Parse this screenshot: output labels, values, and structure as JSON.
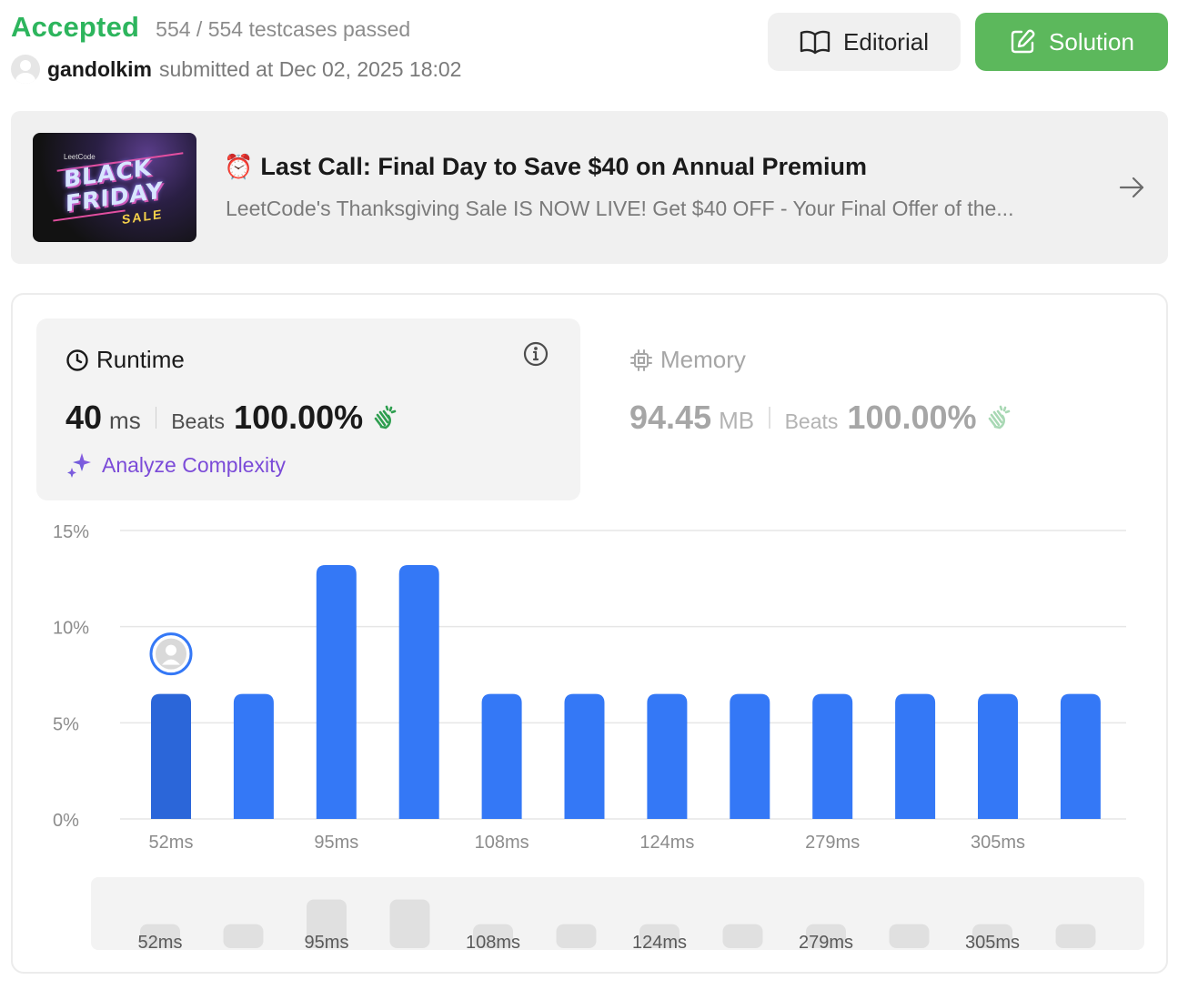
{
  "header": {
    "status": "Accepted",
    "testcases": "554 / 554 testcases passed",
    "username": "gandolkim",
    "submitted_text": "submitted at Dec 02, 2025 18:02",
    "editorial_label": "Editorial",
    "solution_label": "Solution"
  },
  "banner": {
    "image_brand": "LeetCode",
    "image_line1": "BLACK",
    "image_line2": "FRIDAY",
    "image_line3": "SALE",
    "title_emoji": "⏰",
    "title": "Last Call: Final Day to Save $40 on Annual Premium",
    "description": "LeetCode's Thanksgiving Sale IS NOW LIVE! Get $40 OFF - Your Final Offer of the..."
  },
  "runtime": {
    "title": "Runtime",
    "value": "40",
    "unit": "ms",
    "beats_label": "Beats",
    "beats_value": "100.00%",
    "analyze_label": "Analyze Complexity"
  },
  "memory": {
    "title": "Memory",
    "value": "94.45",
    "unit": "MB",
    "beats_label": "Beats",
    "beats_value": "100.00%"
  },
  "colors": {
    "accent_green": "#2db55d",
    "bar_blue": "#3478f6",
    "bar_selected": "#2b66d9",
    "solution_green": "#5cb85c",
    "analyze_purple": "#7b4bd8"
  },
  "chart_data": {
    "type": "bar",
    "y_ticks": [
      "15%",
      "10%",
      "5%",
      "0%"
    ],
    "ylim": [
      0,
      15
    ],
    "values": [
      6.5,
      6.5,
      13.2,
      13.2,
      6.5,
      6.5,
      6.5,
      6.5,
      6.5,
      6.5,
      6.5,
      6.5
    ],
    "x_tick_labels": [
      {
        "index": 0,
        "label": "52ms"
      },
      {
        "index": 2,
        "label": "95ms"
      },
      {
        "index": 4,
        "label": "108ms"
      },
      {
        "index": 6,
        "label": "124ms"
      },
      {
        "index": 8,
        "label": "279ms"
      },
      {
        "index": 10,
        "label": "305ms"
      }
    ],
    "highlight_index": 0,
    "grid": true
  }
}
